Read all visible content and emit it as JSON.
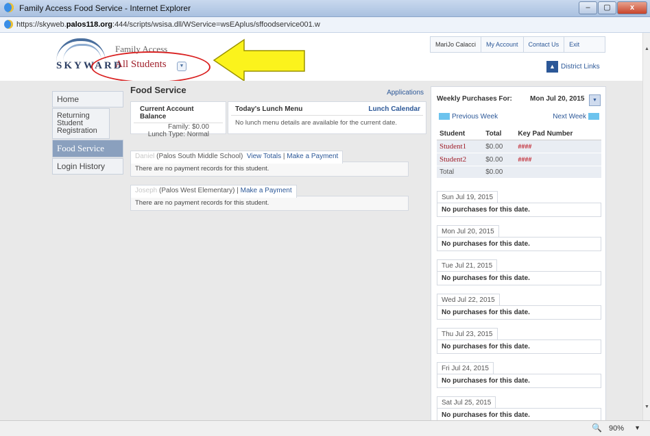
{
  "window": {
    "title": "Family Access Food Service - Internet Explorer",
    "min": "–",
    "max": "▢",
    "close": "x"
  },
  "address": {
    "url_prefix": "https://skyweb.",
    "url_domain": "palos118.org",
    "url_suffix": ":444/scripts/wsisa.dll/WService=wsEAplus/sffoodservice001.w"
  },
  "header": {
    "logo_text": "SKYWARD",
    "family_access": "Family Access",
    "all_students": "All Students",
    "top_links": [
      "MariJo Calacci",
      "My Account",
      "Contact Us",
      "Exit"
    ],
    "district_links": "District Links"
  },
  "nav": {
    "items": [
      {
        "label": "Home"
      },
      {
        "label": "Returning Student Registration"
      },
      {
        "label": "Food Service"
      },
      {
        "label": "Login History"
      }
    ]
  },
  "main": {
    "title": "Food Service",
    "applications": "Applications",
    "account": {
      "heading": "Current Account Balance",
      "family": "Family: $0.00",
      "lunch_type": "Lunch Type: Normal"
    },
    "lunch": {
      "heading": "Today's Lunch Menu",
      "calendar": "Lunch Calendar",
      "message": "No lunch menu details are available for the current date."
    },
    "students": [
      {
        "name": "Daniel",
        "school": "(Palos South Middle School)",
        "links": [
          "View Totals",
          "Make a Payment"
        ],
        "sep": "|",
        "message": "There are no payment records for this student."
      },
      {
        "name": "Joseph",
        "school": "(Palos West Elementary)",
        "links": [
          "Make a Payment"
        ],
        "sep": "|",
        "message": "There are no payment records for this student."
      }
    ]
  },
  "weekly": {
    "label": "Weekly Purchases For:",
    "date": "Mon Jul 20, 2015",
    "prev": "Previous Week",
    "next": "Next Week",
    "columns": [
      "Student",
      "Total",
      "Key Pad Number"
    ],
    "rows": [
      {
        "student": "Student1",
        "total": "$0.00",
        "key": "####"
      },
      {
        "student": "Student2",
        "total": "$0.00",
        "key": "####"
      },
      {
        "student": "Total",
        "total": "$0.00",
        "key": ""
      }
    ],
    "days": [
      {
        "date": "Sun Jul 19, 2015",
        "msg": "No purchases for this date."
      },
      {
        "date": "Mon Jul 20, 2015",
        "msg": "No purchases for this date."
      },
      {
        "date": "Tue Jul 21, 2015",
        "msg": "No purchases for this date."
      },
      {
        "date": "Wed Jul 22, 2015",
        "msg": "No purchases for this date."
      },
      {
        "date": "Thu Jul 23, 2015",
        "msg": "No purchases for this date."
      },
      {
        "date": "Fri Jul 24, 2015",
        "msg": "No purchases for this date."
      },
      {
        "date": "Sat Jul 25, 2015",
        "msg": "No purchases for this date."
      }
    ]
  },
  "status": {
    "zoom": "90%"
  }
}
